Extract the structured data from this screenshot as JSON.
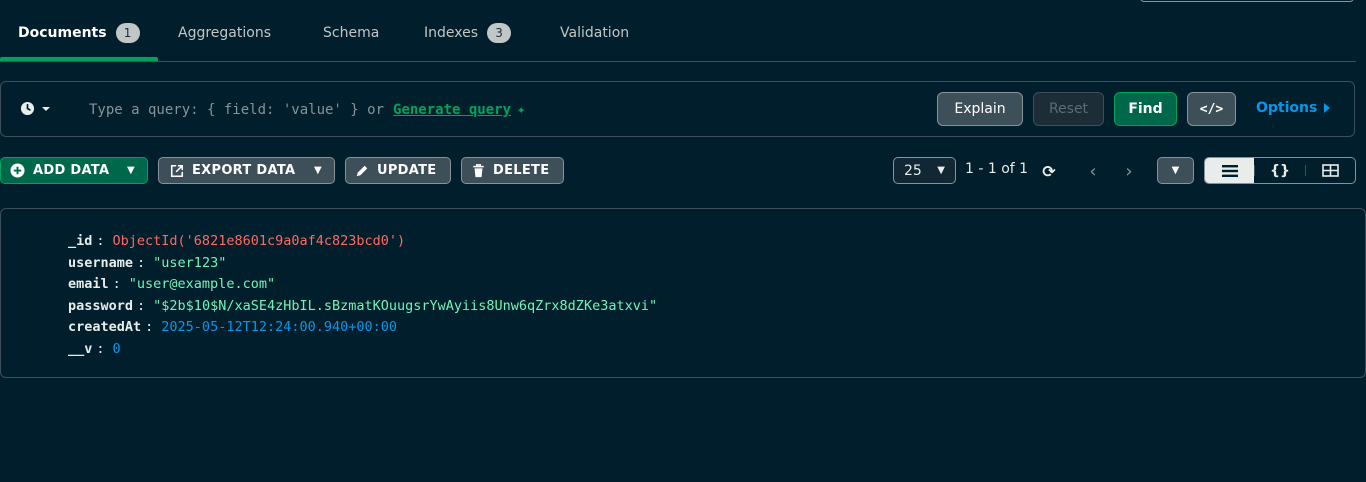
{
  "tabs": [
    {
      "label": "Documents",
      "count": "1"
    },
    {
      "label": "Aggregations"
    },
    {
      "label": "Schema"
    },
    {
      "label": "Indexes",
      "count": "3"
    },
    {
      "label": "Validation"
    }
  ],
  "query": {
    "placeholder": "Type a query: { field: 'value' } or",
    "generate_label": "Generate query",
    "explain_label": "Explain",
    "reset_label": "Reset",
    "find_label": "Find",
    "code_label": "</>",
    "options_label": "Options"
  },
  "toolbar": {
    "add_label": "ADD DATA",
    "export_label": "EXPORT DATA",
    "update_label": "UPDATE",
    "delete_label": "DELETE",
    "page_size": "25",
    "range": "1 - 1 of 1"
  },
  "document": {
    "fields": [
      {
        "key": "_id",
        "value": "ObjectId('6821e8601c9a0af4c823bcd0')",
        "type": "oid"
      },
      {
        "key": "username",
        "value": "\"user123\"",
        "type": "str"
      },
      {
        "key": "email",
        "value": "\"user@example.com\"",
        "type": "str"
      },
      {
        "key": "password",
        "value": "\"$2b$10$N/xaSE4zHbIL.sBzmatKOuugsrYwAyiis8Unw6qZrx8dZKe3atxvi\"",
        "type": "str"
      },
      {
        "key": "createdAt",
        "value": "2025-05-12T12:24:00.940+00:00",
        "type": "date"
      },
      {
        "key": "__v",
        "value": "0",
        "type": "num"
      }
    ]
  },
  "colors": {
    "background": "#001e2b",
    "accent_green": "#00a35c",
    "link_blue": "#0498ec",
    "objectid_red": "#ff6960",
    "string_green": "#71f6ba"
  },
  "icons": [
    "clock-icon",
    "sparkle-icon",
    "plus-circle-icon",
    "export-icon",
    "pencil-icon",
    "trash-icon",
    "refresh-icon",
    "chevron-left-icon",
    "chevron-right-icon",
    "list-view-icon",
    "json-view-icon",
    "table-view-icon"
  ]
}
